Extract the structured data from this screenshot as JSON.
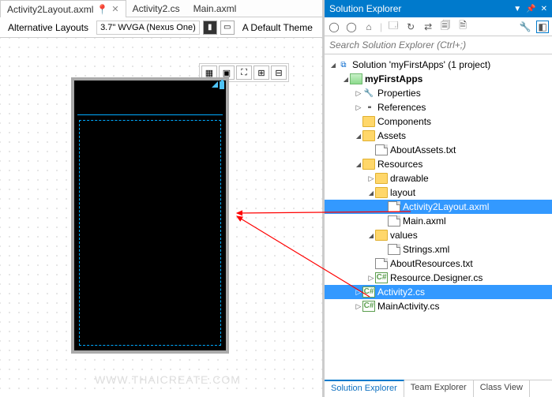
{
  "tabs": [
    {
      "label": "Activity2Layout.axml",
      "active": true
    },
    {
      "label": "Activity2.cs",
      "active": false
    },
    {
      "label": "Main.axml",
      "active": false
    }
  ],
  "designer": {
    "altLayouts": "Alternative Layouts",
    "device": "3.7\" WVGA (Nexus One)",
    "theme": "A Default Theme"
  },
  "panel": {
    "title": "Solution Explorer",
    "searchPlaceholder": "Search Solution Explorer (Ctrl+;)"
  },
  "tree": [
    {
      "d": 0,
      "a": "open",
      "i": "sln",
      "t": "Solution 'myFirstApps' (1 project)"
    },
    {
      "d": 1,
      "a": "open",
      "i": "proj",
      "t": "myFirstApps",
      "bold": true
    },
    {
      "d": 2,
      "a": "closed",
      "i": "wrench",
      "t": "Properties"
    },
    {
      "d": 2,
      "a": "closed",
      "i": "ref",
      "t": "References"
    },
    {
      "d": 2,
      "a": "",
      "i": "folder",
      "t": "Components"
    },
    {
      "d": 2,
      "a": "open",
      "i": "folder",
      "t": "Assets"
    },
    {
      "d": 3,
      "a": "",
      "i": "file",
      "t": "AboutAssets.txt"
    },
    {
      "d": 2,
      "a": "open",
      "i": "folder",
      "t": "Resources"
    },
    {
      "d": 3,
      "a": "closed",
      "i": "folder",
      "t": "drawable"
    },
    {
      "d": 3,
      "a": "open",
      "i": "folder",
      "t": "layout"
    },
    {
      "d": 4,
      "a": "",
      "i": "file",
      "t": "Activity2Layout.axml",
      "sel": true
    },
    {
      "d": 4,
      "a": "",
      "i": "file",
      "t": "Main.axml"
    },
    {
      "d": 3,
      "a": "open",
      "i": "folder",
      "t": "values"
    },
    {
      "d": 4,
      "a": "",
      "i": "file",
      "t": "Strings.xml"
    },
    {
      "d": 3,
      "a": "",
      "i": "file",
      "t": "AboutResources.txt"
    },
    {
      "d": 3,
      "a": "closed",
      "i": "cs",
      "t": "Resource.Designer.cs"
    },
    {
      "d": 2,
      "a": "closed",
      "i": "cs",
      "t": "Activity2.cs",
      "sel": true
    },
    {
      "d": 2,
      "a": "closed",
      "i": "cs",
      "t": "MainActivity.cs"
    }
  ],
  "bottomTabs": [
    {
      "label": "Solution Explorer",
      "active": true
    },
    {
      "label": "Team Explorer",
      "active": false
    },
    {
      "label": "Class View",
      "active": false
    }
  ],
  "watermark": "WWW.THAICREATE.COM"
}
